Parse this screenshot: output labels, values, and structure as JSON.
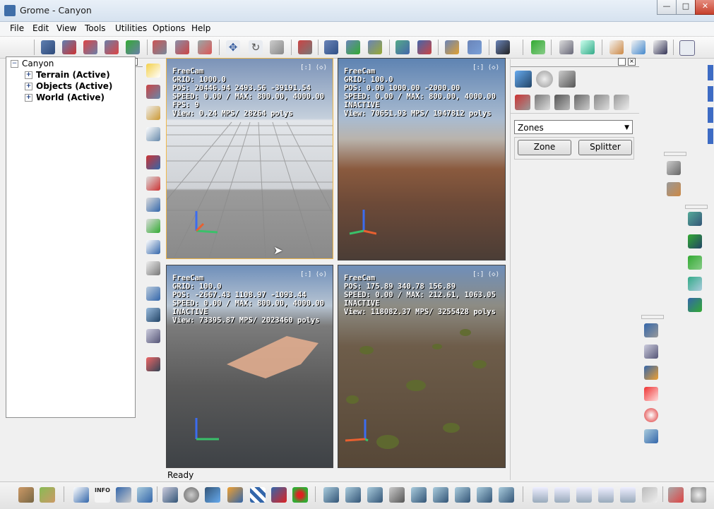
{
  "window": {
    "title": "Grome - Canyon",
    "controls": {
      "minimize": "—",
      "maximize": "□",
      "close": "✕"
    }
  },
  "menu": [
    "File",
    "Edit",
    "View",
    "Tools",
    "Utilities",
    "Options",
    "Help"
  ],
  "tree": {
    "root": "Canyon",
    "children": [
      "Terrain (Active)",
      "Objects (Active)",
      "World (Active)"
    ]
  },
  "viewports": [
    {
      "info": "FreeCam\nGRID: 1000.0\nPOS: 20446.94 2493.56 -39191.54\nSPEED: 0.00 / MAX: 800.00, 4000.00\nFPS: 9\nView: 0.24 MPS/ 28264 polys",
      "buttons": "[:]  ⟨◇⟩"
    },
    {
      "info": "FreeCam\nGRID: 100.0\nPOS: 0.00 1000.00 -2000.00\nSPEED: 0.00 / MAX: 800.00, 4000.00\nINACTIVE\nView: 70651.93 MPS/ 1947812 polys",
      "buttons": "[:]  ⟨◇⟩"
    },
    {
      "info": "FreeCam\nGRID: 100.0\nPOS: -2667.43 1108.97 -1093.44\nSPEED: 0.00 / MAX: 800.00, 4000.00\nINACTIVE\nView: 73395.87 MPS/ 2023460 polys",
      "buttons": "[:]  ⟨◇⟩"
    },
    {
      "info": "FreeCam\nPOS: 175.89 340.78 156.89\nSPEED: 0.00 / MAX: 212.61, 1063.05\nINACTIVE\nView: 118082.37 MPS/ 3255428 polys",
      "buttons": "[:]  ⟨◇⟩"
    }
  ],
  "right_panel": {
    "select_value": "Zones",
    "buttons": [
      "Zone",
      "Splitter"
    ]
  },
  "status": "Ready",
  "icons": {
    "top_toolbar": [
      "spline-icon",
      "spline-delete-icon",
      "road-icon",
      "road-edit-icon",
      "checklist-icon",
      "brush-icon",
      "paint-bucket-icon",
      "eraser-icon",
      "move-icon",
      "rotate-icon",
      "scale-icon",
      "link-icon",
      "chain-icon",
      "chain-add-icon",
      "chain-remove-icon",
      "transfer-icon",
      "swap-icon",
      "group-icon",
      "ungroup-icon",
      "save-icon",
      "flag-icon",
      "doc-view-icon",
      "doc-select-icon",
      "page-icon",
      "page-list-icon",
      "page-edit-icon",
      "fullscreen-icon"
    ],
    "left_tabs": [
      "terrain-grid-icon",
      "object-bucket-icon",
      "world-person-icon",
      "light-sun-icon",
      "layer-terrain-icon",
      "book-icon",
      "page-icon"
    ],
    "vertical_tools": [
      "sun-icon",
      "road-tool-icon",
      "book-icon",
      "doc-icon",
      "paint-layer-icon",
      "texture-icon",
      "blend-icon",
      "mask-icon",
      "zoom-icon",
      "plugin-icon",
      "grid-tool-icon",
      "monitor-icon",
      "keyboard-icon",
      "magnet-icon"
    ],
    "right_tabs": [
      "paint-tool-icon",
      "globe-icon",
      "person-tool-icon",
      "brush-red-icon",
      "vertex-icon",
      "paint-icon",
      "pencil-icon",
      "grass-icon",
      "ground-icon"
    ],
    "bottom_toolbar": [
      "terrain-layer-icon",
      "grass-layer-icon",
      "height-icon",
      "info-icon",
      "image-icon",
      "water-icon",
      "mesh-icon",
      "disc-icon",
      "cube-icon",
      "globe-tool-icon",
      "checker-icon",
      "rect-icon",
      "tree-icon",
      "sculpt-icon",
      "sculpt2-icon",
      "sculpt3-icon",
      "sculpt4-icon",
      "sculpt5-icon",
      "sculpt6-icon",
      "sculpt7-icon",
      "sculpt8-icon",
      "sculpt9-icon",
      "mountain-icon",
      "mountain2-icon",
      "mountain3-icon",
      "mountain4-icon",
      "mountain5-icon",
      "noise-icon",
      "tools-icon",
      "mask-face-icon"
    ],
    "far_right": [
      "blue-tab1-icon",
      "blue-tab2-icon",
      "blue-tab3-icon",
      "blue-tab4-icon",
      "bucket-icon",
      "eraser-tool-icon",
      "pen-tool-icon",
      "person-arrows-icon",
      "import-icon",
      "mountain-tool-icon",
      "export-icon",
      "paint-brush-icon",
      "stamp-icon",
      "triangle-icon",
      "red-gradient-icon",
      "flower-icon",
      "layers-icon"
    ]
  },
  "colors": {
    "selected_viewport": "#f0b84a",
    "viewport_border": "#444444"
  }
}
